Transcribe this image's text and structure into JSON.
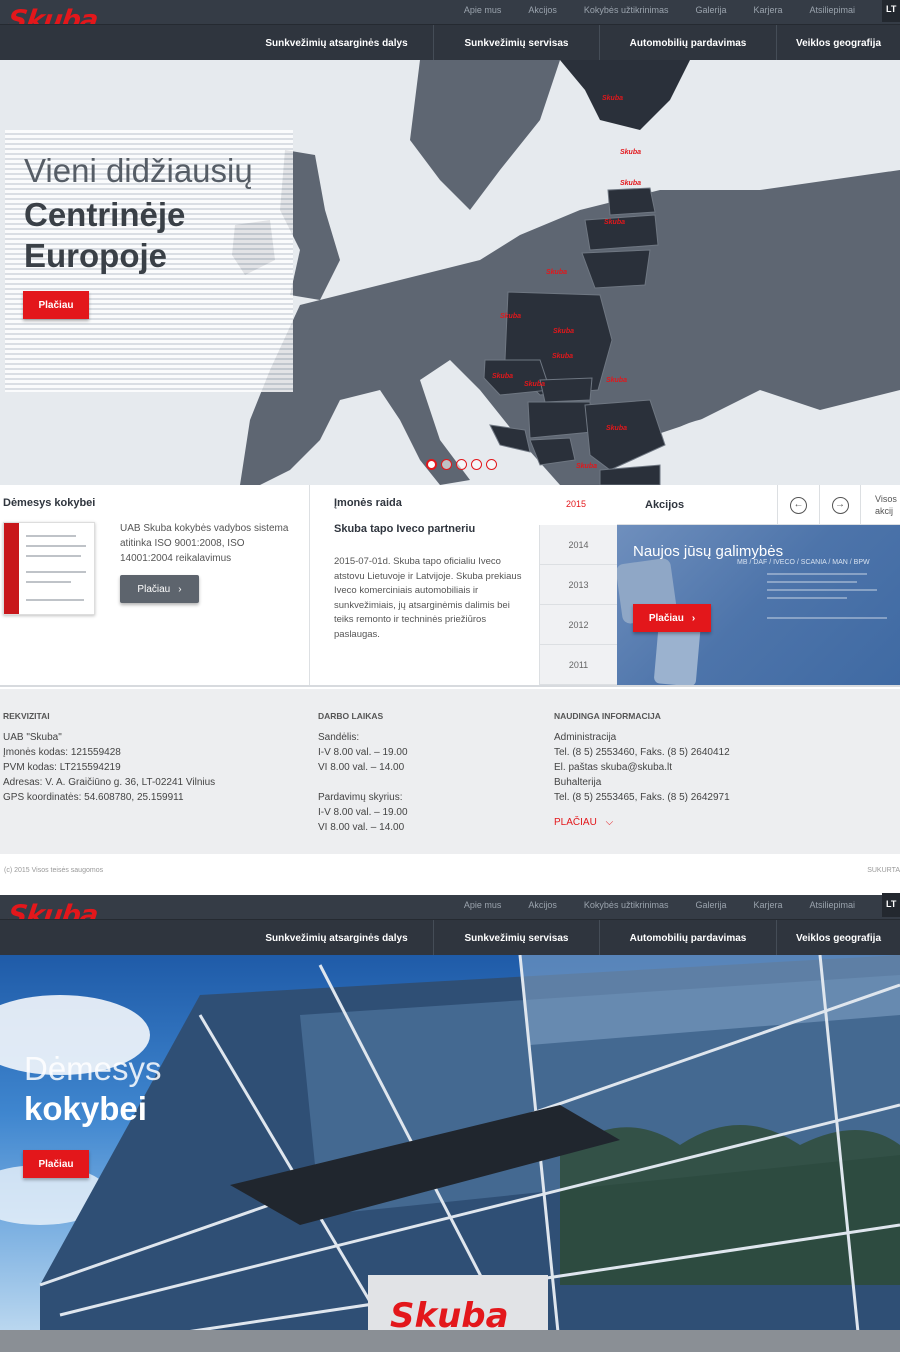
{
  "brand": {
    "logo": "Skuba",
    "accent": "#e3171b",
    "dark": "#2f353e"
  },
  "top_nav": [
    "Apie mus",
    "Akcijos",
    "Kokybės užtikrinimas",
    "Galerija",
    "Karjera",
    "Atsiliepimai"
  ],
  "lang": "LT",
  "main_nav": [
    "Sunkvežimių atsarginės dalys",
    "Sunkvežimių servisas",
    "Automobilių pardavimas",
    "Veiklos geografija"
  ],
  "hero1": {
    "light": "Vieni didžiausių",
    "bold_1": "Centrinėje",
    "bold_2": "Europoje",
    "button": "Plačiau",
    "map_label": "Skuba",
    "slides": 5,
    "active_slide": 1
  },
  "quality": {
    "title": "Dėmesys kokybei",
    "text": "UAB Skuba kokybės vadybos sistema atitinka ISO 9001:2008, ISO 14001:2004 reikalavimus",
    "button": "Plačiau"
  },
  "history": {
    "title": "Įmonės raida",
    "current_year": "2015",
    "headline": "Skuba tapo Iveco partneriu",
    "body": "2015-07-01d. Skuba tapo oficialiu Iveco atstovu Lietuvoje ir Latvijoje. Skuba prekiaus Iveco komerciniais automobiliais ir sunkvežimiais, jų atsarginėmis dalimis bei teiks remonto ir techninės priežiūros paslaugas.",
    "years": [
      "2014",
      "2013",
      "2012",
      "2011"
    ]
  },
  "promo": {
    "title": "Akcijos",
    "all_line1": "Visos",
    "all_line2": "akcij",
    "headline": "Naujos jūsų galimybės",
    "brands": "MB / DAF / IVECO / SCANIA / MAN / BPW",
    "button": "Plačiau"
  },
  "footer": {
    "col1": {
      "heading": "REKVIZITAI",
      "lines": [
        "UAB \"Skuba\"",
        "Įmonės kodas: 121559428",
        "PVM kodas: LT215594219",
        "Adresas: V. A. Graičiūno g. 36, LT-02241 Vilnius",
        "GPS koordinatės: 54.608780, 25.159911"
      ]
    },
    "col2": {
      "heading": "DARBO LAIKAS",
      "lines": [
        "Sandėlis:",
        "I-V 8.00 val. – 19.00",
        "VI  8.00 val. – 14.00",
        "",
        "Pardavimų skyrius:",
        "I-V 8.00 val. – 19.00",
        "VI  8.00 val. – 14.00"
      ]
    },
    "col3": {
      "heading": "NAUDINGA INFORMACIJA",
      "lines": [
        "Administracija",
        "Tel. (8 5) 2553460, Faks. (8 5) 2640412",
        "El. paštas skuba@skuba.lt",
        "Buhalterija",
        "Tel. (8 5) 2553465, Faks. (8 5) 2642971"
      ],
      "more": "PLAČIAU"
    },
    "copyright": "(c) 2015 Visos teisės saugomos",
    "made_by": "SUKURTA"
  },
  "hero2": {
    "light": "Dėmesys",
    "bold": "kokybei",
    "button": "Plačiau",
    "sign": "Skuba"
  }
}
